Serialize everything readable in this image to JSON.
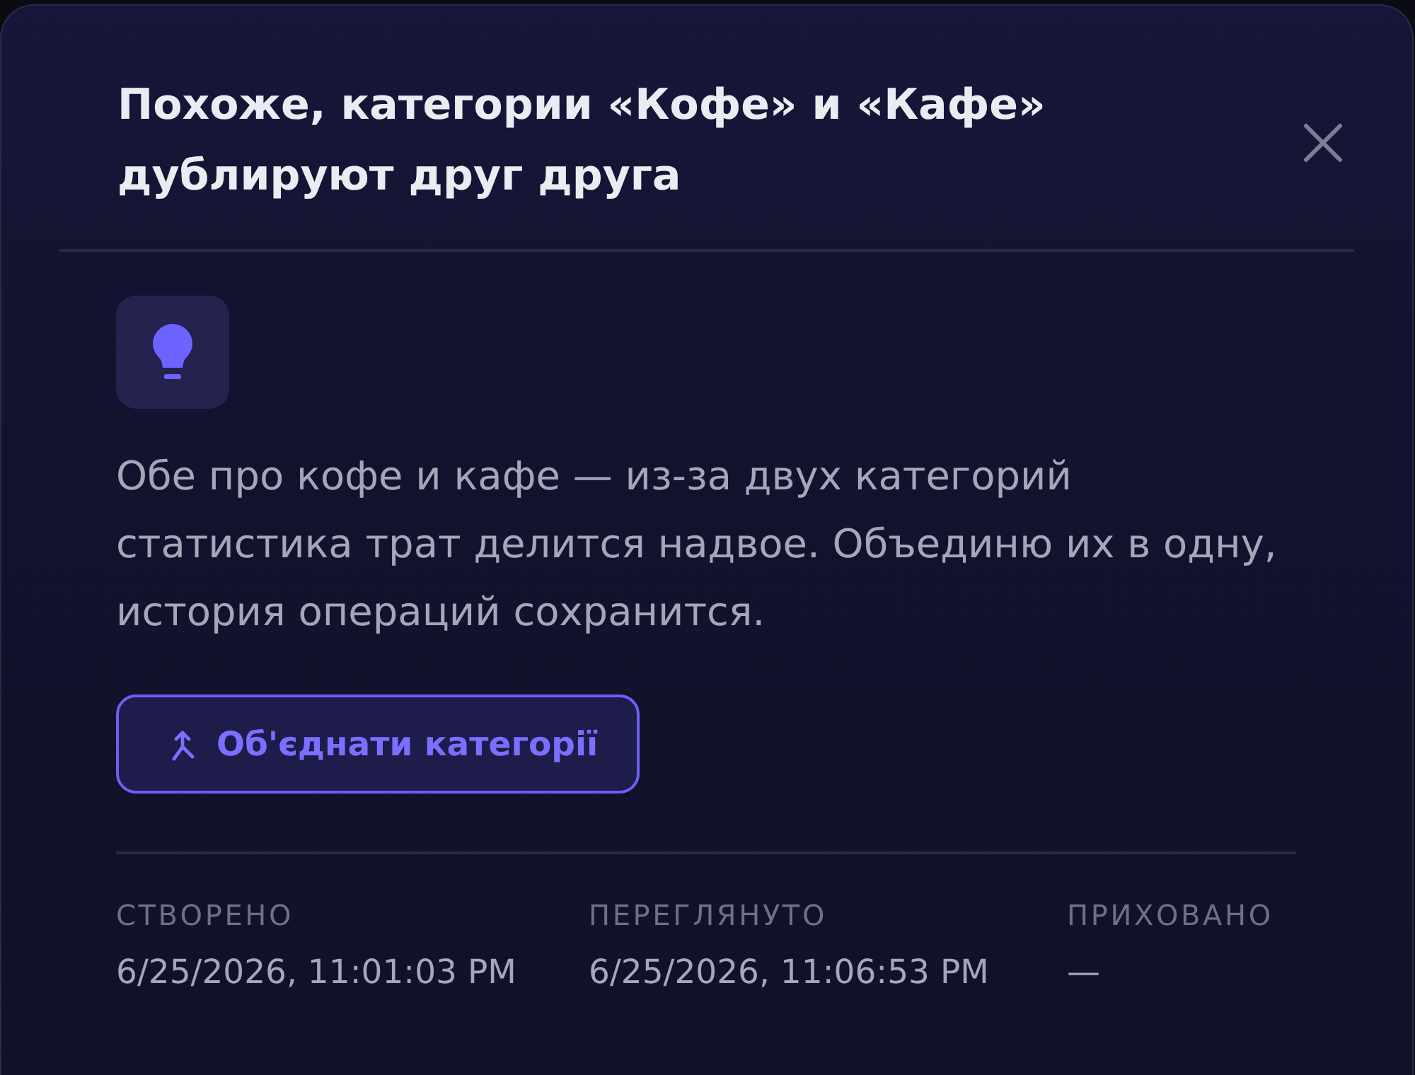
{
  "dialog": {
    "title": "Похоже, категории «Кофе» и «Кафе» дублируют друг друга",
    "description": "Обе про кофе и кафе — из-за двух категорий статистика трат делится надвое. Объединю их в одну, история операций сохранится.",
    "action": {
      "label": "Об'єднати категорії"
    },
    "meta": [
      {
        "label": "СТВОРЕНО",
        "value": "6/25/2026, 11:01:03 PM"
      },
      {
        "label": "ПЕРЕГЛЯНУТО",
        "value": "6/25/2026, 11:06:53 PM"
      },
      {
        "label": "ПРИХОВАНО",
        "value": "—"
      }
    ]
  }
}
